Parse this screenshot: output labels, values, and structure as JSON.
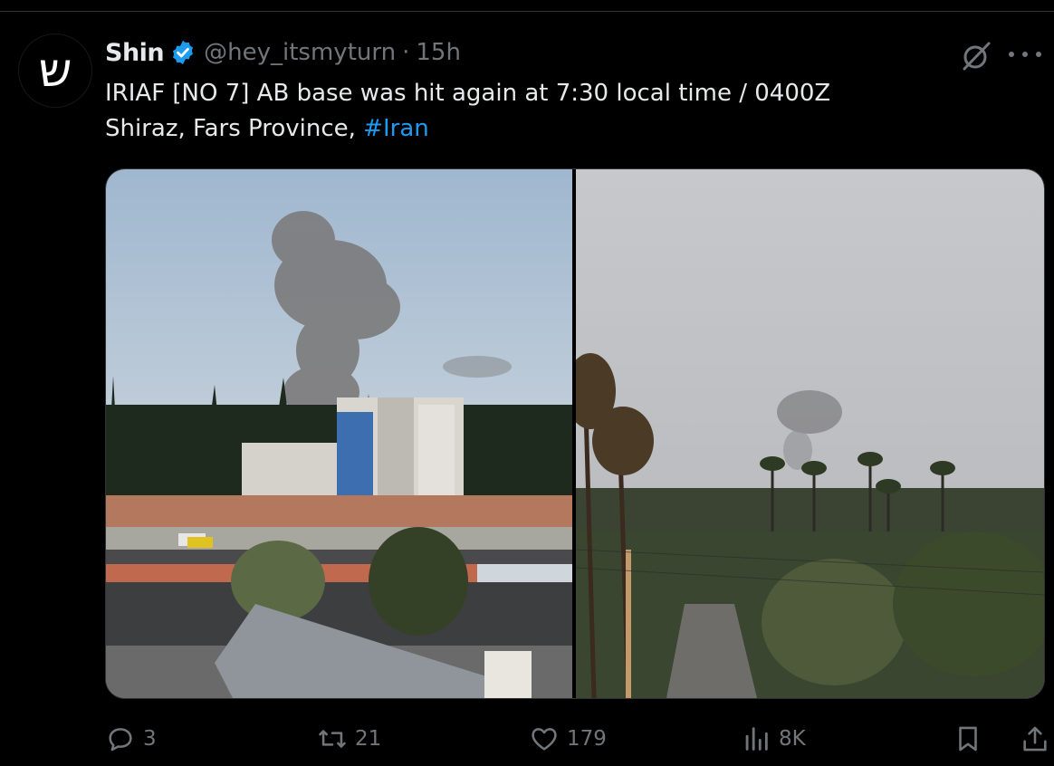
{
  "tweet": {
    "author_name": "Shin",
    "avatar_glyph": "ש",
    "handle": "@hey_itsmyturn",
    "separator": "·",
    "time": "15h",
    "text_line1": "IRIAF [NO 7] AB base was hit again at 7:30 local time / 0400Z",
    "text_line2": "Shiraz, Fars Province, ",
    "hashtag": "#Iran"
  },
  "media": {
    "photos": [
      {
        "subject": "smoke plume rising behind buildings and highway"
      },
      {
        "subject": "distant smoke plume over palm trees and road"
      }
    ]
  },
  "actions": {
    "replies": "3",
    "retweets": "21",
    "likes": "179",
    "views": "8K"
  },
  "icons": {
    "verified": "verified-badge-icon",
    "grok": "grok-icon",
    "more": "more-dots-icon",
    "reply": "reply-icon",
    "retweet": "retweet-icon",
    "like": "heart-icon",
    "views": "views-icon",
    "bookmark": "bookmark-icon",
    "share": "share-icon"
  },
  "colors": {
    "background": "#000000",
    "text": "#e7e9ea",
    "muted": "#71767b",
    "accent": "#1d9bf0"
  }
}
